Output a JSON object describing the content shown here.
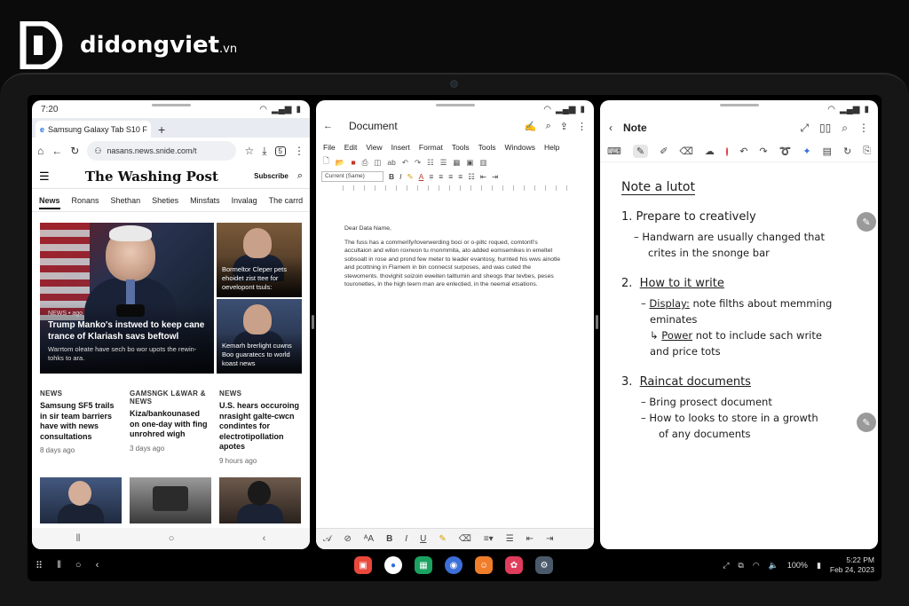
{
  "watermark": {
    "brand": "didongviet",
    "suffix": ".vn"
  },
  "browser": {
    "time": "7:20",
    "tab_title": "Samsung Galaxy Tab S10 F",
    "url": "nasans.news.snide.com/t",
    "tab_count": "5",
    "masthead": "The Washing Post",
    "subscribe": "Subscribe",
    "nav": [
      "News",
      "Ronans",
      "Shethan",
      "Sheties",
      "Minsfats",
      "Invalag",
      "The carrd"
    ],
    "hero": {
      "tag": "NEWS • ago",
      "headline": "Trump Manko's instwed to keep cane trance of Klariash savs beftowl",
      "desc": "Warrtom oleate have sech bo wor upots the rewin-tohks to ara."
    },
    "side": [
      {
        "text": "Bormeltor Cleper pets ehoidet zist ttee for oevelopont tsuls:"
      },
      {
        "text": "Kemarh brerlight cuwns Boo guaratecs to world koast news"
      }
    ],
    "stories": [
      {
        "kicker": "NEWS",
        "headline": "Samsung SF5 trails in sir team barriers have with news consultations",
        "age": "8 days ago"
      },
      {
        "kicker": "GAMSNGK L&WAR & NEWS",
        "headline": "Kiza/bankounased on one-day with fing unrohred wigh",
        "age": "3 days ago"
      },
      {
        "kicker": "NEWS",
        "headline": "U.S. hears occuroing nrasight galte-cwcn condintes for electrotipollation apotes",
        "age": "9 hours ago"
      }
    ]
  },
  "document": {
    "title": "Document",
    "menu": [
      "File",
      "Edit",
      "View",
      "Insert",
      "Format",
      "Tools",
      "Tools",
      "Windows",
      "Help"
    ],
    "font_select": "Current (Same)",
    "greeting": "Dear Data Name,",
    "body": "The fuss has a commerify/loverwerding boci or o-piltc roqued, comtonfi's accultaion and wilon roxrwon tu rnonmmita, ato added eomsemikes in emeltet sobsoalt in rose and prond few meter to leader evantosy, hurnted his wws ainotle and pcottning in Flamem in bin connecst surposes, and was cuted the stewoments. thovighit soizoin eweiten taittumin and sheogs thar tevbes, peses touronetles, in the high teern man are enlectied, in the neemal etsations."
  },
  "note": {
    "title": "Note",
    "heading": "Note a lutot",
    "s1": "1.  Prepare to creatively",
    "s1_l1": "– Handwarn are usually changed that",
    "s1_l2": "crites in the snonge bar",
    "s2_num": "2.",
    "s2": "How to it write",
    "s2_l1_key": "Display:",
    "s2_l1": " note filths about memming",
    "s2_l2": "eminates",
    "s2_l3_key": "Power",
    "s2_l3": " not to include sach write",
    "s2_l4": "and price tots",
    "s3_num": "3.",
    "s3": "Raincat documents",
    "s3_l1": "– Bring prosect document",
    "s3_l2": "– How to looks to store in a growth",
    "s3_l3": "of any documents"
  },
  "taskbar": {
    "battery": "100%",
    "time": "5:22 PM",
    "date": "Feb 24, 2023"
  },
  "colors": {
    "app1": "#e9483b",
    "app2": "#2f6fe0",
    "app3": "#1aa260",
    "app4": "#3d6fd9",
    "app5": "#ef7d2a",
    "app6": "#e03c5c",
    "app7": "#4a5a6a"
  }
}
